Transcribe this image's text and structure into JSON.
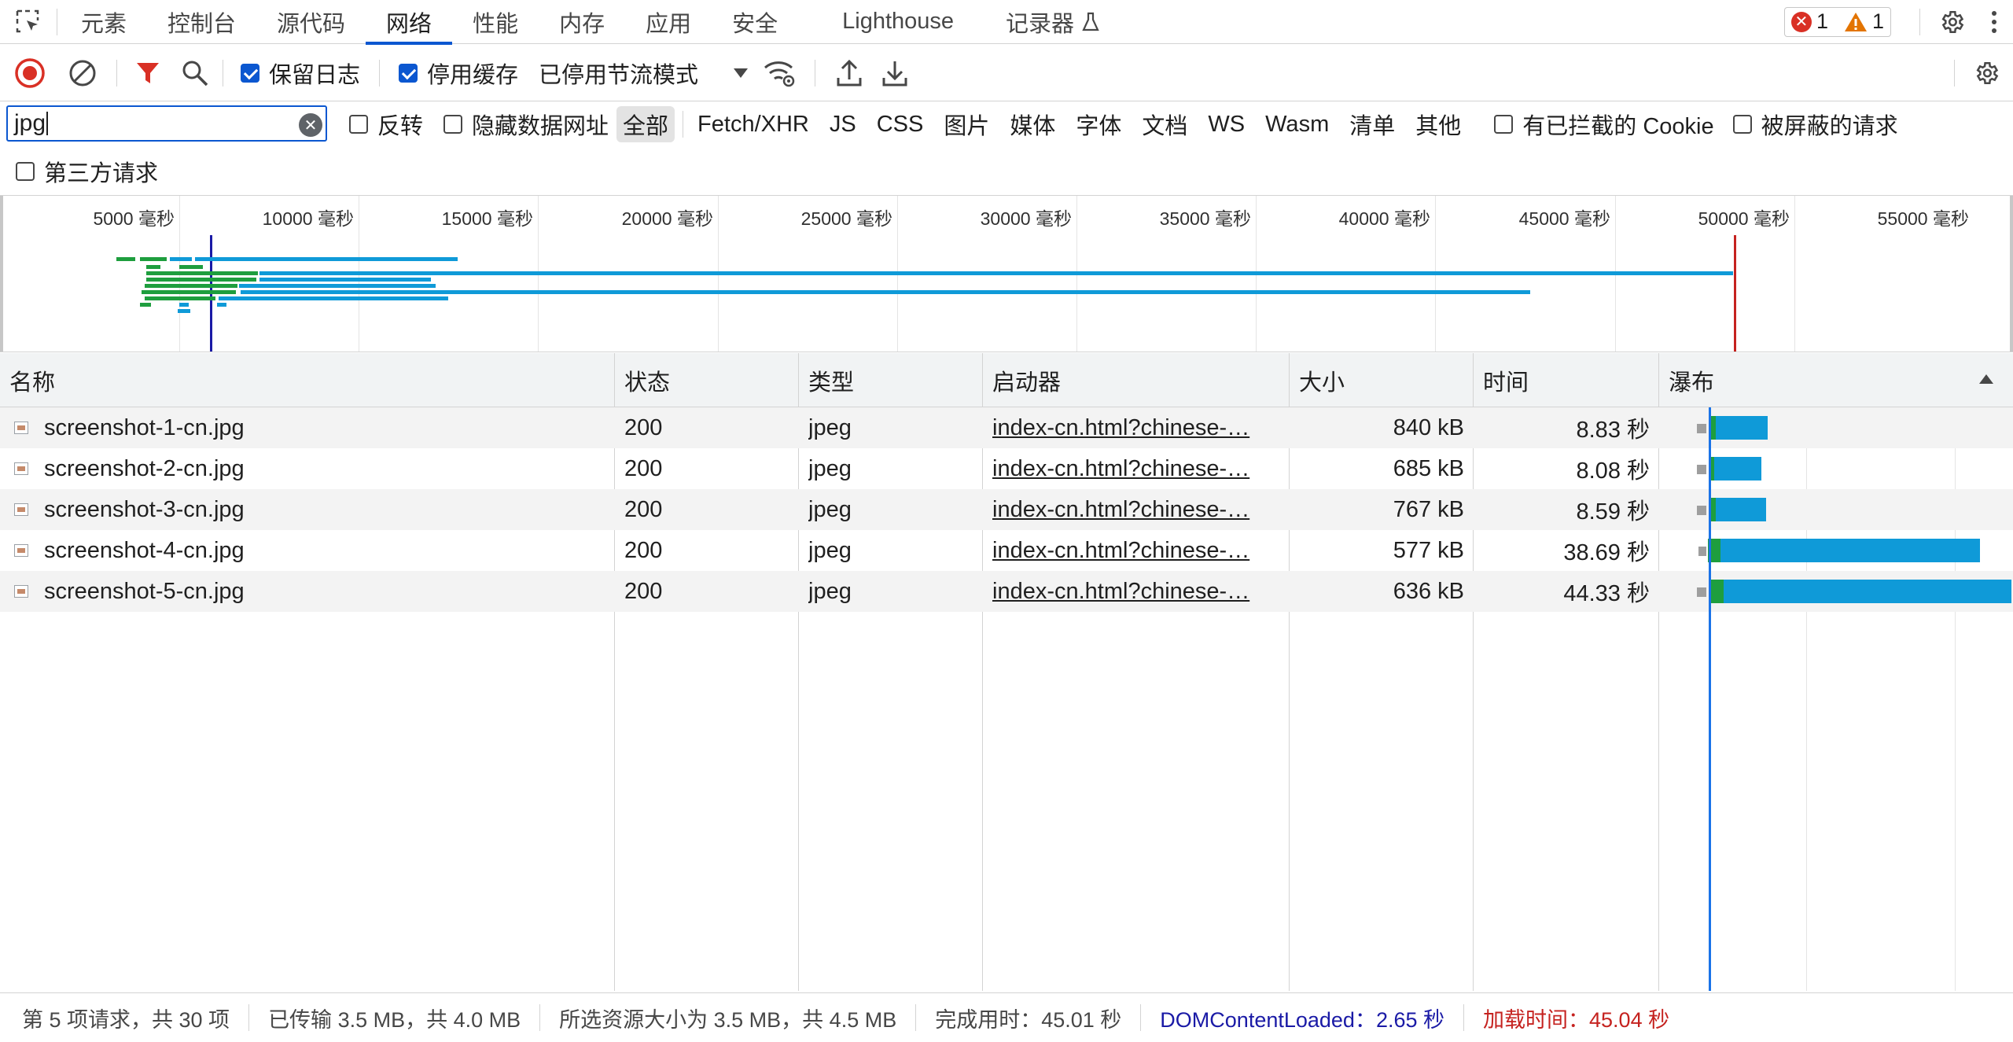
{
  "tabs": [
    {
      "label": "元素"
    },
    {
      "label": "控制台"
    },
    {
      "label": "源代码"
    },
    {
      "label": "网络"
    },
    {
      "label": "性能"
    },
    {
      "label": "内存"
    },
    {
      "label": "应用"
    },
    {
      "label": "安全"
    },
    {
      "label": "Lighthouse"
    },
    {
      "label": "记录器"
    }
  ],
  "active_tab": "网络",
  "issues": {
    "errors": "1",
    "warnings": "1"
  },
  "toolbar": {
    "preserve_log": "保留日志",
    "disable_cache": "停用缓存",
    "throttling": "已停用节流模式"
  },
  "filter": {
    "value": "jpg",
    "invert": "反转",
    "hide_data_urls": "隐藏数据网址",
    "types": [
      "全部",
      "Fetch/XHR",
      "JS",
      "CSS",
      "图片",
      "媒体",
      "字体",
      "文档",
      "WS",
      "Wasm",
      "清单",
      "其他"
    ],
    "blocked_cookies": "有已拦截的 Cookie",
    "blocked_requests": "被屏蔽的请求",
    "third_party": "第三方请求"
  },
  "overview": {
    "ticks": [
      "5000 毫秒",
      "10000 毫秒",
      "15000 毫秒",
      "20000 毫秒",
      "25000 毫秒",
      "30000 毫秒",
      "35000 毫秒",
      "40000 毫秒",
      "45000 毫秒",
      "50000 毫秒",
      "55000 毫秒"
    ]
  },
  "table": {
    "headers": {
      "name": "名称",
      "status": "状态",
      "type": "类型",
      "initiator": "启动器",
      "size": "大小",
      "time": "时间",
      "waterfall": "瀑布"
    },
    "rows": [
      {
        "name": "screenshot-1-cn.jpg",
        "status": "200",
        "type": "jpeg",
        "initiator": "index-cn.html?chinese-…",
        "size": "840 kB",
        "time": "8.83 秒"
      },
      {
        "name": "screenshot-2-cn.jpg",
        "status": "200",
        "type": "jpeg",
        "initiator": "index-cn.html?chinese-…",
        "size": "685 kB",
        "time": "8.08 秒"
      },
      {
        "name": "screenshot-3-cn.jpg",
        "status": "200",
        "type": "jpeg",
        "initiator": "index-cn.html?chinese-…",
        "size": "767 kB",
        "time": "8.59 秒"
      },
      {
        "name": "screenshot-4-cn.jpg",
        "status": "200",
        "type": "jpeg",
        "initiator": "index-cn.html?chinese-…",
        "size": "577 kB",
        "time": "38.69 秒"
      },
      {
        "name": "screenshot-5-cn.jpg",
        "status": "200",
        "type": "jpeg",
        "initiator": "index-cn.html?chinese-…",
        "size": "636 kB",
        "time": "44.33 秒"
      }
    ]
  },
  "status": {
    "requests": "第 5 项请求，共 30 项",
    "transferred": "已传输 3.5 MB，共 4.0 MB",
    "resources": "所选资源大小为 3.5 MB，共 4.5 MB",
    "finish": "完成用时：45.01 秒",
    "dcl": "DOMContentLoaded：2.65 秒",
    "load": "加载时间：45.04 秒"
  },
  "colors": {
    "accent": "#0b57d0",
    "record": "#d93025",
    "dcl": "#1a1aa6",
    "load": "#c5221f",
    "bar_blue": "#0f9ad8",
    "bar_green": "#1e9e3e"
  }
}
